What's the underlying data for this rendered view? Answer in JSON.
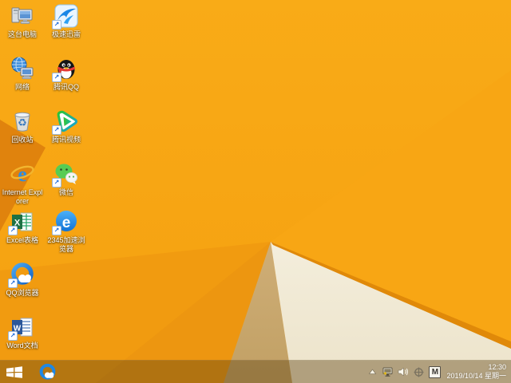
{
  "wallpaper": {
    "palette": {
      "orange_main_top": "#F9AB17",
      "orange_main_bottom": "#F5A010",
      "orange_fan1": "#F19B10",
      "orange_fan2": "#ED9610",
      "orange_deep_triangle": "#E0830D",
      "cream_facet": "#F4EEDC",
      "tan_facet": "#C9A86F",
      "facet_edge": "#E08909"
    }
  },
  "desktop": {
    "icons": [
      {
        "label": "这台电脑",
        "icon": "this-pc-icon",
        "shortcut": false
      },
      {
        "label": "极速迅雷",
        "icon": "xunlei-icon",
        "shortcut": true
      },
      {
        "label": "网络",
        "icon": "network-icon",
        "shortcut": false
      },
      {
        "label": "腾讯QQ",
        "icon": "qq-icon",
        "shortcut": true
      },
      {
        "label": "回收站",
        "icon": "recycle-bin-icon",
        "shortcut": false
      },
      {
        "label": "腾讯视频",
        "icon": "tencent-video-icon",
        "shortcut": true
      },
      {
        "label": "Internet Explorer",
        "icon": "ie-icon",
        "shortcut": false
      },
      {
        "label": "微信",
        "icon": "wechat-icon",
        "shortcut": true
      },
      {
        "label": "Excel表格",
        "icon": "excel-icon",
        "shortcut": true
      },
      {
        "label": "2345加速浏览器",
        "icon": "2345-browser-icon",
        "shortcut": true
      },
      {
        "label": "QQ浏览器",
        "icon": "qq-browser-icon",
        "shortcut": true
      },
      {
        "label": "Word文档",
        "icon": "word-icon",
        "shortcut": true
      }
    ],
    "shortcut_arrow_glyph": "↗"
  },
  "taskbar": {
    "pinned": [
      {
        "icon": "qq-browser-icon"
      }
    ],
    "tray": {
      "icons": [
        {
          "name": "hidden-icons-chevron"
        },
        {
          "name": "network-status-icon"
        },
        {
          "name": "volume-icon"
        },
        {
          "name": "ime-tool-icon"
        },
        {
          "name": "ime-mode-badge",
          "label": "M"
        }
      ],
      "clock_time": "12:30",
      "clock_date": "2019/10/14 星期一"
    }
  }
}
